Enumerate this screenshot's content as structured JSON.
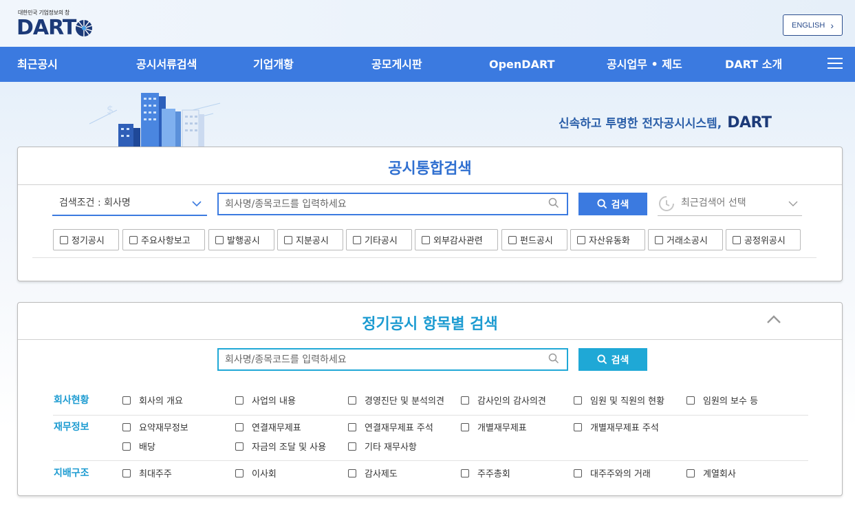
{
  "header": {
    "logo_sub": "대한민국 기업정보의 창",
    "logo_text": "DART",
    "english_label": "ENGLISH",
    "english_chevron": "›"
  },
  "nav": {
    "items": [
      {
        "label": "최근공시"
      },
      {
        "label": "공시서류검색"
      },
      {
        "label": "기업개황"
      },
      {
        "label": "공모게시판"
      },
      {
        "label": "OpenDART"
      },
      {
        "label": "공시업무 • 제도"
      },
      {
        "label": "DART 소개"
      }
    ],
    "menu_icon": "hamburger-icon"
  },
  "hero": {
    "slogan": "신속하고 투명한 전자공시시스템,",
    "slogan_brand": "DART"
  },
  "integrated_search": {
    "title": "공시통합검색",
    "condition_value": "검색조건 : 회사명",
    "input_placeholder": "회사명/종목코드를 입력하세요",
    "search_button": "검색",
    "recent_value": "최근검색어 선택",
    "filters": [
      {
        "label": "정기공시"
      },
      {
        "label": "주요사항보고"
      },
      {
        "label": "발행공시"
      },
      {
        "label": "지분공시"
      },
      {
        "label": "기타공시"
      },
      {
        "label": "외부감사관련"
      },
      {
        "label": "펀드공시"
      },
      {
        "label": "자산유동화"
      },
      {
        "label": "거래소공시"
      },
      {
        "label": "공정위공시"
      }
    ]
  },
  "periodic_search": {
    "title": "정기공시 항목별 검색",
    "input_placeholder": "회사명/종목코드를 입력하세요",
    "search_button": "검색",
    "collapse_icon": "chevron-up-icon",
    "categories": [
      {
        "label": "회사현황",
        "items": [
          "회사의 개요",
          "사업의 내용",
          "경영진단 및 분석의견",
          "감사인의 감사의견",
          "임원 및 직원의 현황",
          "임원의 보수 등"
        ]
      },
      {
        "label": "재무정보",
        "items": [
          "요약재무정보",
          "연결재무제표",
          "연결재무제표 주석",
          "개별재무제표",
          "개별재무제표 주석",
          "배당",
          "자금의 조달 및 사용",
          "기타 재무사항"
        ]
      },
      {
        "label": "지배구조",
        "items": [
          "최대주주",
          "이사회",
          "감사제도",
          "주주총회",
          "대주주와의 거래",
          "계열회사"
        ]
      }
    ]
  },
  "colors": {
    "nav_bg": "#3b7ae0",
    "primary_button": "#3b7ae0",
    "secondary_button": "#1fa8d6",
    "title_blue": "#2f6fd0",
    "title_cyan": "#1c9bd1",
    "brand_navy": "#1c3a78"
  }
}
